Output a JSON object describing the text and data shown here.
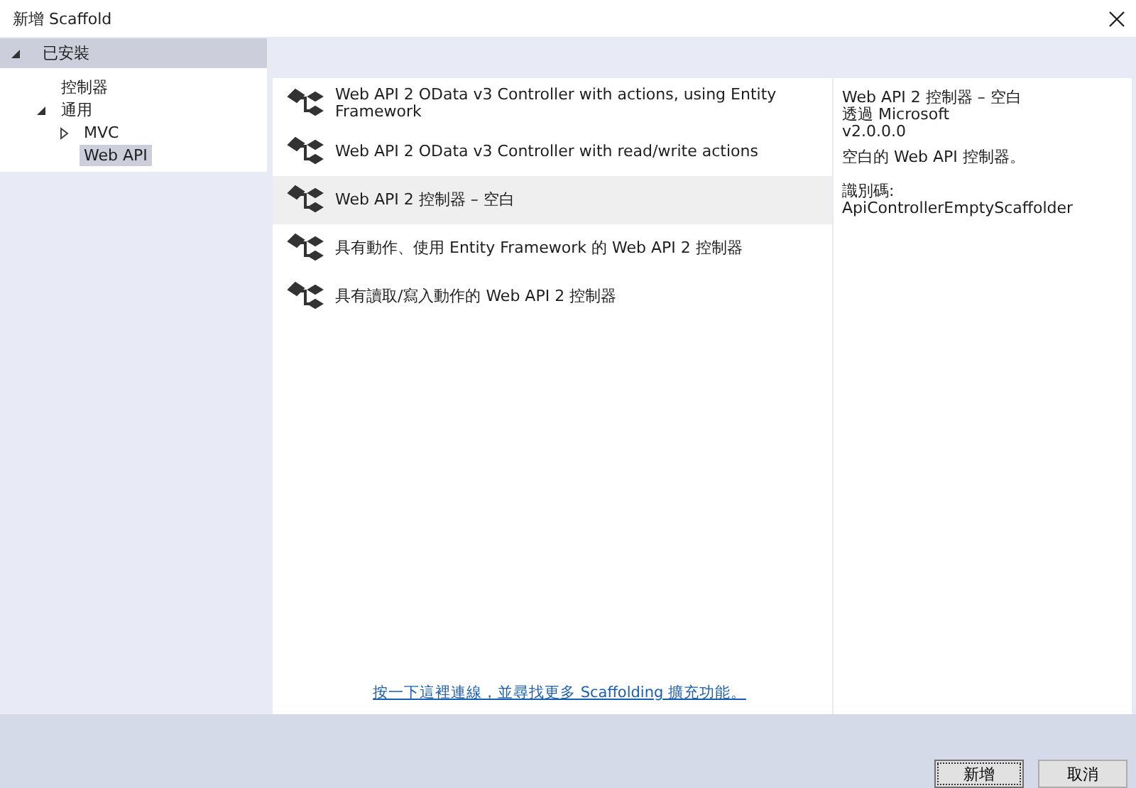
{
  "window": {
    "title": "新增 Scaffold"
  },
  "sidebar": {
    "header": {
      "label": "已安裝",
      "expanded": true
    },
    "items": [
      {
        "label": "控制器",
        "selected": false
      },
      {
        "label": "通用",
        "expanded": true,
        "selected": false,
        "children": [
          {
            "label": "MVC",
            "expanded": false,
            "selected": false
          },
          {
            "label": "Web API",
            "selected": true
          }
        ]
      }
    ]
  },
  "templates": [
    {
      "label": "Web API 2 OData v3 Controller with actions, using Entity Framework",
      "selected": false
    },
    {
      "label": "Web API 2 OData v3 Controller with read/write actions",
      "selected": false
    },
    {
      "label": "Web API 2 控制器 – 空白",
      "selected": true
    },
    {
      "label": "具有動作、使用 Entity Framework 的 Web API 2 控制器",
      "selected": false
    },
    {
      "label": "具有讀取/寫入動作的 Web API 2 控制器",
      "selected": false
    }
  ],
  "link": "按一下這裡連線，並尋找更多 Scaffolding 擴充功能。",
  "details": {
    "title": "Web API 2 控制器 – 空白",
    "author": "透過 Microsoft",
    "version": "v2.0.0.0",
    "description": "空白的 Web API 控制器。",
    "id": "識別碼: ApiControllerEmptyScaffolder"
  },
  "buttons": [
    {
      "label": "新增",
      "default": true
    },
    {
      "label": "取消",
      "default": false
    }
  ]
}
